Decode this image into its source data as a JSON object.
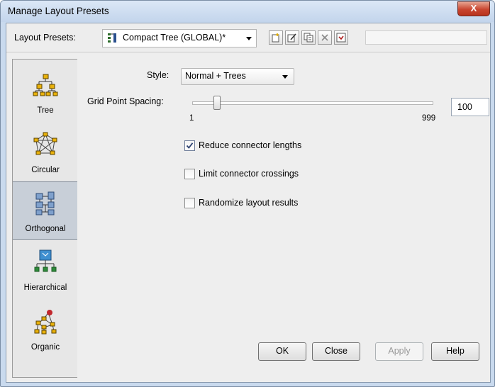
{
  "window": {
    "title": "Manage Layout Presets",
    "close_label": "X"
  },
  "toolbar": {
    "presets_label": "Layout Presets:",
    "selected_preset": "Compact Tree (GLOBAL)*",
    "icons": [
      "new-preset-icon",
      "edit-preset-icon",
      "copy-preset-icon",
      "delete-preset-icon",
      "apply-preset-icon"
    ]
  },
  "sidebar": {
    "items": [
      {
        "label": "Tree",
        "icon": "tree-layout-icon"
      },
      {
        "label": "Circular",
        "icon": "circular-layout-icon"
      },
      {
        "label": "Orthogonal",
        "icon": "orthogonal-layout-icon",
        "selected": true
      },
      {
        "label": "Hierarchical",
        "icon": "hierarchical-layout-icon"
      },
      {
        "label": "Organic",
        "icon": "organic-layout-icon"
      }
    ]
  },
  "settings": {
    "style_label": "Style:",
    "style_value": "Normal + Trees",
    "grid_label": "Grid Point Spacing:",
    "grid_min": "1",
    "grid_max": "999",
    "grid_value": "100",
    "grid_slider_level": 100,
    "options": [
      {
        "label": "Reduce connector lengths",
        "checked": true
      },
      {
        "label": "Limit connector crossings",
        "checked": false
      },
      {
        "label": "Randomize layout results",
        "checked": false
      }
    ]
  },
  "buttons": {
    "ok": "OK",
    "close": "Close",
    "apply": "Apply",
    "help": "Help"
  },
  "colors": {
    "title_bar": "#c9daee",
    "close_button": "#c8452f",
    "selected_item": "#c8cfd8",
    "dialog_bg": "#eeeeee"
  }
}
